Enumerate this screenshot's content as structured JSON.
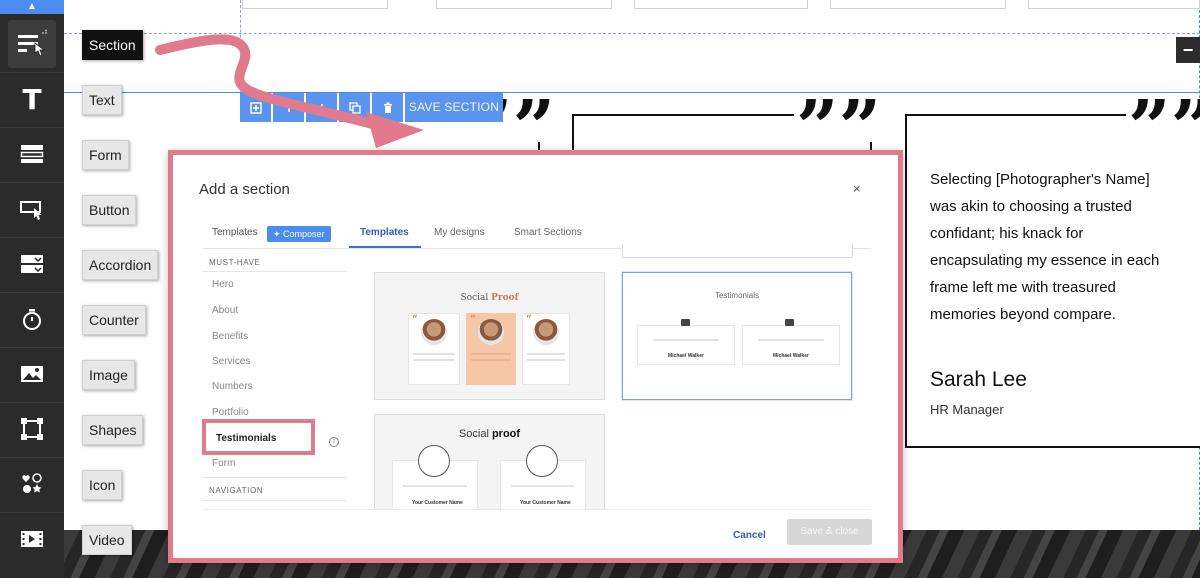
{
  "toolbar": {
    "tools": [
      {
        "name": "section",
        "tooltip": "Section"
      },
      {
        "name": "text",
        "tooltip": "Text"
      },
      {
        "name": "form",
        "tooltip": "Form"
      },
      {
        "name": "button",
        "tooltip": "Button"
      },
      {
        "name": "accordion",
        "tooltip": "Accordion"
      },
      {
        "name": "counter",
        "tooltip": "Counter"
      },
      {
        "name": "image",
        "tooltip": "Image"
      },
      {
        "name": "shapes",
        "tooltip": "Shapes"
      },
      {
        "name": "icon",
        "tooltip": "Icon"
      },
      {
        "name": "video",
        "tooltip": "Video"
      }
    ],
    "text_tool_glyph": "T"
  },
  "section_toolbar": {
    "save_label": "SAVE SECTION"
  },
  "canvas": {
    "quote_glyph": "”",
    "testimonial": {
      "quote": "Selecting [Photographer's Name] was akin to choosing a trusted confidant; his knack for encapsulating my essence in each frame left me with treasured memories beyond compare.",
      "name": "Sarah Lee",
      "role": "HR Manager"
    },
    "minus_glyph": "−"
  },
  "modal": {
    "title": "Add a section",
    "close_glyph": "×",
    "tab_templates_left": "Templates",
    "composer_label": "Composer",
    "tabs": [
      "Templates",
      "My designs",
      "Smart Sections"
    ],
    "active_tab": "Templates",
    "section_headers": [
      "MUST-HAVE",
      "NAVIGATION"
    ],
    "categories": [
      "Hero",
      "About",
      "Benefits",
      "Services",
      "Numbers",
      "Portfolio",
      "Testimonials",
      "Form"
    ],
    "active_category": "Testimonials",
    "info_glyph": "i",
    "thumbnails": {
      "social_proof_title_a": "Social",
      "social_proof_title_b": "Proof",
      "testimonials_title": "Testimonials",
      "social_proof2_a": "Social",
      "social_proof2_b": "proof",
      "thumb_person": "Michael Walker",
      "thumb_customer": "Your Customer Name",
      "thumb_quote": "“"
    },
    "cancel_label": "Cancel",
    "save_close_label": "Save & close"
  },
  "colors": {
    "highlight": "#e07a8c",
    "accent": "#4a8cf0",
    "toolbar_bg": "#2b2b2b"
  }
}
